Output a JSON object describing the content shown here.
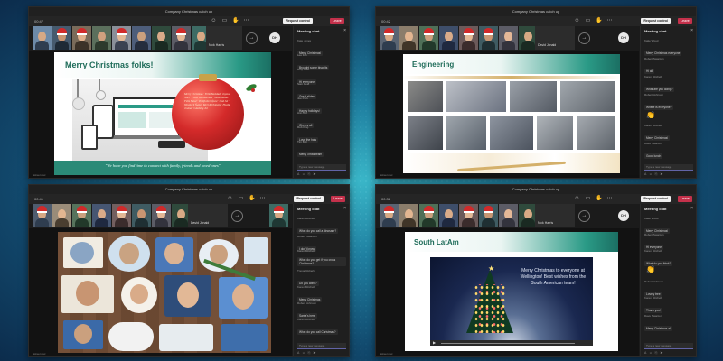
{
  "app": {
    "meeting_title": "Company Christmas catch up",
    "request_control": "Request control",
    "leave": "Leave",
    "footer": "Screen rec"
  },
  "toolbar": {
    "icons": [
      "people-icon",
      "chat-icon",
      "react-icon",
      "rooms-icon",
      "apps-icon",
      "more-icon",
      "camera-icon",
      "mic-icon",
      "share-icon"
    ]
  },
  "accent": {
    "teams_purple": "#6264a7",
    "leave_red": "#c4314b",
    "slide_green": "#1d6b58"
  },
  "windows": [
    {
      "timer": "00:47",
      "presenter_name": "Nick Harris",
      "avatar_initials": "DH",
      "slide_title": "Merry Christmas folks!",
      "slide_caption": "\"We hope you find time to connect with family, friends and loved ones\"",
      "chat": {
        "header": "Meeting chat",
        "messages": [
          {
            "who": "Kate Jones",
            "text": "Merry Christmas!"
          },
          {
            "who": "Lee Fox",
            "text": "Brought some biscuits"
          },
          {
            "who": "Amy Cole",
            "text": "Hi everyone"
          },
          {
            "who": "Sam Reid",
            "text": "Great slides"
          },
          {
            "who": "Joe Park",
            "text": "Happy holidays!"
          },
          {
            "who": "Ann Wu",
            "text": "Cheers all"
          },
          {
            "who": "Rob King",
            "text": "Love the hats"
          },
          {
            "who": "Tim Bell",
            "text": "Merry Xmas team"
          }
        ],
        "input_placeholder": "Type a new message"
      }
    },
    {
      "timer": "00:42",
      "presenter_name": "David Jonald",
      "avatar_initials": "DH",
      "slide_title": "Engineering",
      "chat": {
        "header": "Meeting chat",
        "messages": [
          {
            "who": "Katie Wood",
            "text": "Merry Christmas everyone"
          },
          {
            "who": "Robert Swanton",
            "text": "Hi all"
          },
          {
            "who": "Karen Mitchell",
            "text": "What are you doing?"
          },
          {
            "who": "Robert Johnson",
            "text": "Where is everyone?"
          },
          {
            "who": "Karen Mitchell",
            "text": "Merry Christmas!"
          },
          {
            "who": "Dave Swanton",
            "text": "Good lunch"
          }
        ],
        "input_placeholder": "Type a new message"
      }
    },
    {
      "timer": "00:41",
      "presenter_name": "David Jonald",
      "chat": {
        "header": "Meeting chat",
        "messages": [
          {
            "who": "Karen Mitchell",
            "text": "What do you call a dinosaur?"
          },
          {
            "who": "Robert Swanton",
            "text": "I don't know"
          },
          {
            "who": "Karen Mitchell",
            "text": "What do you get if you cross Christmas?"
          },
          {
            "who": "Trevor Roberts",
            "text": "Do you want?"
          },
          {
            "who": "Karen Mitchell",
            "text": "Merry Christmas"
          },
          {
            "who": "Robert Johnson",
            "text": "Santa's here"
          },
          {
            "who": "Karen Mitchell",
            "text": "What do you call Christmas?"
          }
        ],
        "input_placeholder": "Type a new message"
      }
    },
    {
      "timer": "00:38",
      "presenter_name": "Nick Harris",
      "avatar_initials": "DH",
      "slide_title": "South LatAm",
      "slide_message": "Merry Christmas to everyone at Wellington! Best wishes from the South American team!",
      "chat": {
        "header": "Meeting chat",
        "messages": [
          {
            "who": "Katie Wood",
            "text": "Merry Christmas!"
          },
          {
            "who": "Robert Swanton",
            "text": "Hi everyone"
          },
          {
            "who": "Karen Mitchell",
            "text": "What do you think?"
          },
          {
            "who": "Robert Johnson",
            "text": "Lovely tree"
          },
          {
            "who": "Karen Mitchell",
            "text": "Thank you!"
          },
          {
            "who": "Dave Swanton",
            "text": "Merry Christmas all"
          }
        ],
        "input_placeholder": "Type a new message"
      }
    }
  ]
}
